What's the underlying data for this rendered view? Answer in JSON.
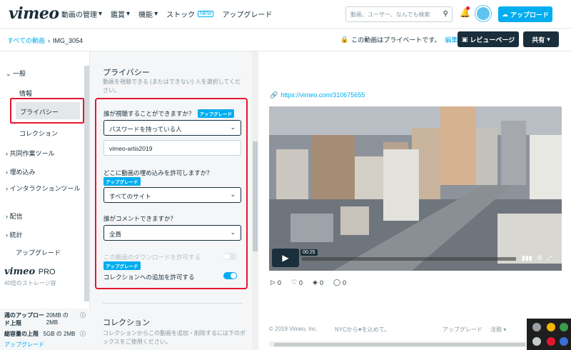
{
  "header": {
    "logo": "vimeo",
    "nav": [
      {
        "label": "動画の管理",
        "has_menu": true
      },
      {
        "label": "鑑賞",
        "has_menu": true
      },
      {
        "label": "機能",
        "has_menu": true
      },
      {
        "label": "ストック",
        "has_menu": false,
        "badge": "NEW"
      },
      {
        "label": "アップグレード",
        "has_menu": false
      }
    ],
    "search_placeholder": "動画、ユーザー、なんでも検索",
    "upload_label": "アップロード"
  },
  "subbar": {
    "breadcrumb_root": "すべての動画",
    "breadcrumb_current": "IMG_3054",
    "privacy_status": "この動画はプライベートです。",
    "edit_link": "編集",
    "review_button": "レビューページ",
    "share_button": "共有"
  },
  "sidebar": {
    "general": "一般",
    "info": "情報",
    "privacy": "プライバシー",
    "collection": "コレクション",
    "collab": "共同作業ツール",
    "embed": "埋め込み",
    "interaction": "インタラクションツール",
    "distribution": "配信",
    "stats": "統計",
    "upgrade": "アップグレード",
    "pro_logo": "vimeo",
    "pro_suffix": "PRO",
    "pro_text": "40倍のストレージ容",
    "quota_weekly_label": "週のアップロード上限",
    "quota_weekly_value": "20MB の 2MB",
    "quota_total_label": "総容量の上限",
    "quota_total_value": "5GB の 2MB",
    "quota_upgrade": "アップグレード"
  },
  "privacy_panel": {
    "title": "プライバシー",
    "description": "動画を視聴できる (またはできない) 人を選択してください。",
    "who_can_view_label": "誰が視聴することができますか？",
    "upgrade_badge": "アップグレード",
    "who_can_view_value": "パスワードを持っている人",
    "password_value": "vimeo-artis2019",
    "embed_label": "どこに動画の埋め込みを許可しますか？",
    "embed_value": "すべてのサイト",
    "comment_label": "誰がコメントできますか？",
    "comment_value": "全員",
    "download_label": "この動画のダウンロードを許可する",
    "download_enabled": false,
    "add_collection_label": "コレクションへの追加を許可する",
    "add_collection_enabled": true,
    "collection_title": "コレクション",
    "collection_desc": "コレクションからこの動画を追加・削除するには下のボックスをご使用ください。"
  },
  "video": {
    "url": "https://vimeo.com/310675655",
    "time": "00:25",
    "progress_fraction": 0.02,
    "stats": {
      "plays": "0",
      "likes": "0",
      "collections": "0",
      "comments": "0"
    }
  },
  "footer": {
    "copyright": "© 2019 Vimeo, Inc.",
    "made_with": "NYCから",
    "made_with_suffix": "を込めて。",
    "upgrade": "アップグレード",
    "legal": "法務"
  },
  "colors": {
    "accent": "#00adef",
    "dark": "#1a2e3b",
    "highlight": "#e5172f"
  }
}
